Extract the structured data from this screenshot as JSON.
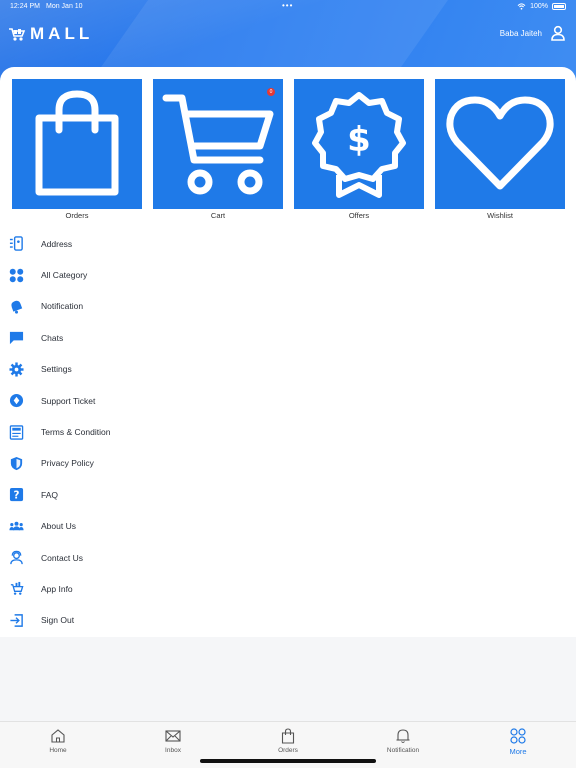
{
  "status": {
    "time": "12:24 PM",
    "date": "Mon Jan 10",
    "battery": "100%"
  },
  "header": {
    "logo_text": "MALL",
    "user_name": "Baba Jaiteh"
  },
  "colors": {
    "primary": "#1f7ae8",
    "badge": "#e53935"
  },
  "tiles": [
    {
      "label": "Orders",
      "icon": "shopping-bag-icon"
    },
    {
      "label": "Cart",
      "icon": "cart-icon",
      "badge": "0"
    },
    {
      "label": "Offers",
      "icon": "offer-badge-icon"
    },
    {
      "label": "Wishlist",
      "icon": "heart-icon"
    }
  ],
  "menu": [
    {
      "label": "Address",
      "icon": "address-icon"
    },
    {
      "label": "All Category",
      "icon": "category-grid-icon"
    },
    {
      "label": "Notification",
      "icon": "bell-icon"
    },
    {
      "label": "Chats",
      "icon": "chat-icon"
    },
    {
      "label": "Settings",
      "icon": "gear-icon"
    },
    {
      "label": "Support Ticket",
      "icon": "support-ticket-icon"
    },
    {
      "label": "Terms & Condition",
      "icon": "terms-icon"
    },
    {
      "label": "Privacy Policy",
      "icon": "shield-icon"
    },
    {
      "label": "FAQ",
      "icon": "question-icon"
    },
    {
      "label": "About Us",
      "icon": "group-icon"
    },
    {
      "label": "Contact Us",
      "icon": "contact-icon"
    },
    {
      "label": "App Info",
      "icon": "app-info-icon"
    },
    {
      "label": "Sign Out",
      "icon": "sign-out-icon"
    }
  ],
  "tabs": [
    {
      "label": "Home",
      "icon": "home-icon"
    },
    {
      "label": "Inbox",
      "icon": "inbox-icon"
    },
    {
      "label": "Orders",
      "icon": "orders-bag-icon"
    },
    {
      "label": "Notification",
      "icon": "bell-icon"
    },
    {
      "label": "More",
      "icon": "more-grid-icon",
      "active": true
    }
  ]
}
